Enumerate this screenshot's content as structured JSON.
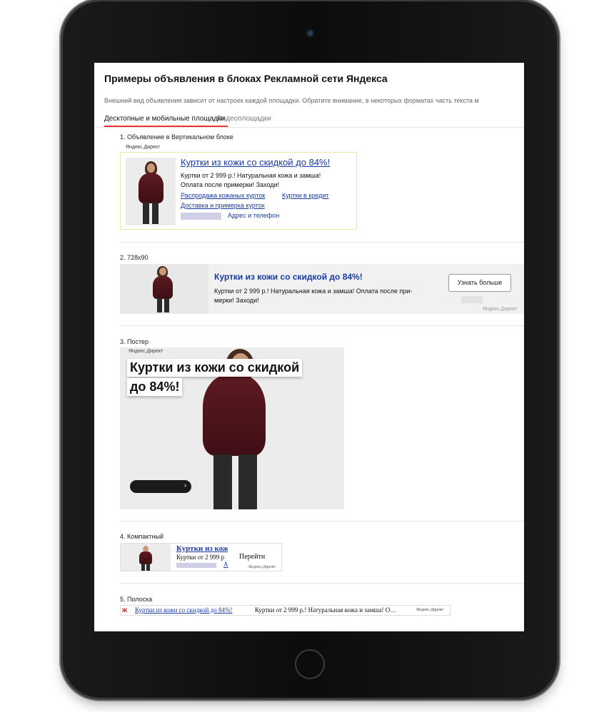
{
  "page": {
    "title": "Примеры объявления в блоках Рекламной сети Яндекса",
    "subtitle": "Внешний вид объявления зависит от настроек каждой площадки. Обратите внимание, в некоторых форматах часть текста м"
  },
  "tabs": [
    {
      "label": "Десктопные и мобильные площадки",
      "active": true
    },
    {
      "label": "Видеоплощадки",
      "active": false
    }
  ],
  "brand": "Яндекс.Директ",
  "ad": {
    "title": "Куртки из кожи со скидкой до 84%!",
    "text_line1": "Куртки от 2 999 р.! Натуральная кожа и замша!",
    "text_line2": "Оплата после примерки! Заходи!",
    "sitelinks": [
      "Распродажа кожаных курток",
      "Куртки в кредит",
      "Доставка и примерка курток"
    ],
    "contacts_link": "Адрес и телефон"
  },
  "sections": [
    {
      "label": "1. Объявление в Вертикальном блоке"
    },
    {
      "label": "2. 728x90"
    },
    {
      "label": "3. Постер"
    },
    {
      "label": "4. Компактный"
    },
    {
      "label": "5. Полоска"
    }
  ],
  "leaderboard": {
    "text_line1": "Куртки от 2 999 р.! Натуральная кожа и замша! Оплата после при-",
    "text_line2": "мерки! Заходи!",
    "button": "Узнать больше"
  },
  "poster": {
    "headline_line1": "Куртки из кожи со скидкой",
    "headline_line2": "до 84%!",
    "button_arrow": "›"
  },
  "compact": {
    "title": "Куртки из кож",
    "text": "Куртки от 2 999 р",
    "link": "А",
    "button": "Перейти"
  },
  "strip": {
    "title": "Куртки из кожи со скидкой до 84%!",
    "text": "Куртки от 2 999 р.! Натуральная кожа и замша! О…"
  },
  "colors": {
    "link": "#1a3aa8",
    "tab_underline": "#e33",
    "jacket": "#5e1a22"
  }
}
